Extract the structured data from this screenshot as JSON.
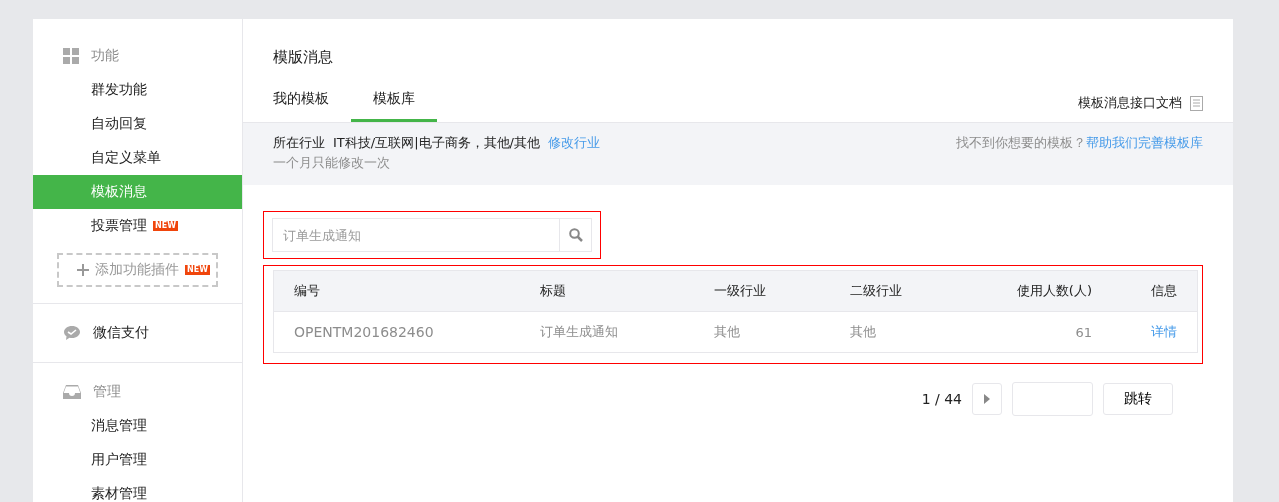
{
  "sidebar": {
    "sections": [
      {
        "kind": "grid",
        "title": "功能",
        "items": [
          {
            "label": "群发功能",
            "selected": false
          },
          {
            "label": "自动回复",
            "selected": false
          },
          {
            "label": "自定义菜单",
            "selected": false
          },
          {
            "label": "模板消息",
            "selected": true
          },
          {
            "label": "投票管理",
            "selected": false,
            "badge": "NEW"
          }
        ],
        "add_button": {
          "label": "添加功能插件",
          "badge": "NEW"
        }
      },
      {
        "kind": "pay",
        "title": "微信支付"
      },
      {
        "kind": "inbox",
        "title": "管理",
        "items": [
          {
            "label": "消息管理",
            "selected": false
          },
          {
            "label": "用户管理",
            "selected": false
          },
          {
            "label": "素材管理",
            "selected": false
          }
        ]
      }
    ]
  },
  "page_title": "模版消息",
  "tabs": [
    {
      "label": "我的模板",
      "selected": false
    },
    {
      "label": "模板库",
      "selected": true
    }
  ],
  "doc_link": "模板消息接口文档",
  "industry": {
    "label": "所在行业",
    "value": "IT科技/互联网|电子商务，其他/其他",
    "change_link": "修改行业",
    "note": "一个月只能修改一次",
    "help_text": "找不到你想要的模板？",
    "help_link": "帮助我们完善模板库"
  },
  "search": {
    "placeholder": "订单生成通知",
    "highlighted": true
  },
  "table": {
    "highlighted": true,
    "columns": [
      "编号",
      "标题",
      "一级行业",
      "二级行业",
      "使用人数(人)",
      "信息"
    ],
    "rows": [
      {
        "cells": [
          "OPENTM201682460",
          "订单生成通知",
          "其他",
          "其他",
          "61"
        ],
        "link": "详情"
      }
    ]
  },
  "pagination": {
    "page": "1 / 44",
    "jump_button": "跳转"
  }
}
